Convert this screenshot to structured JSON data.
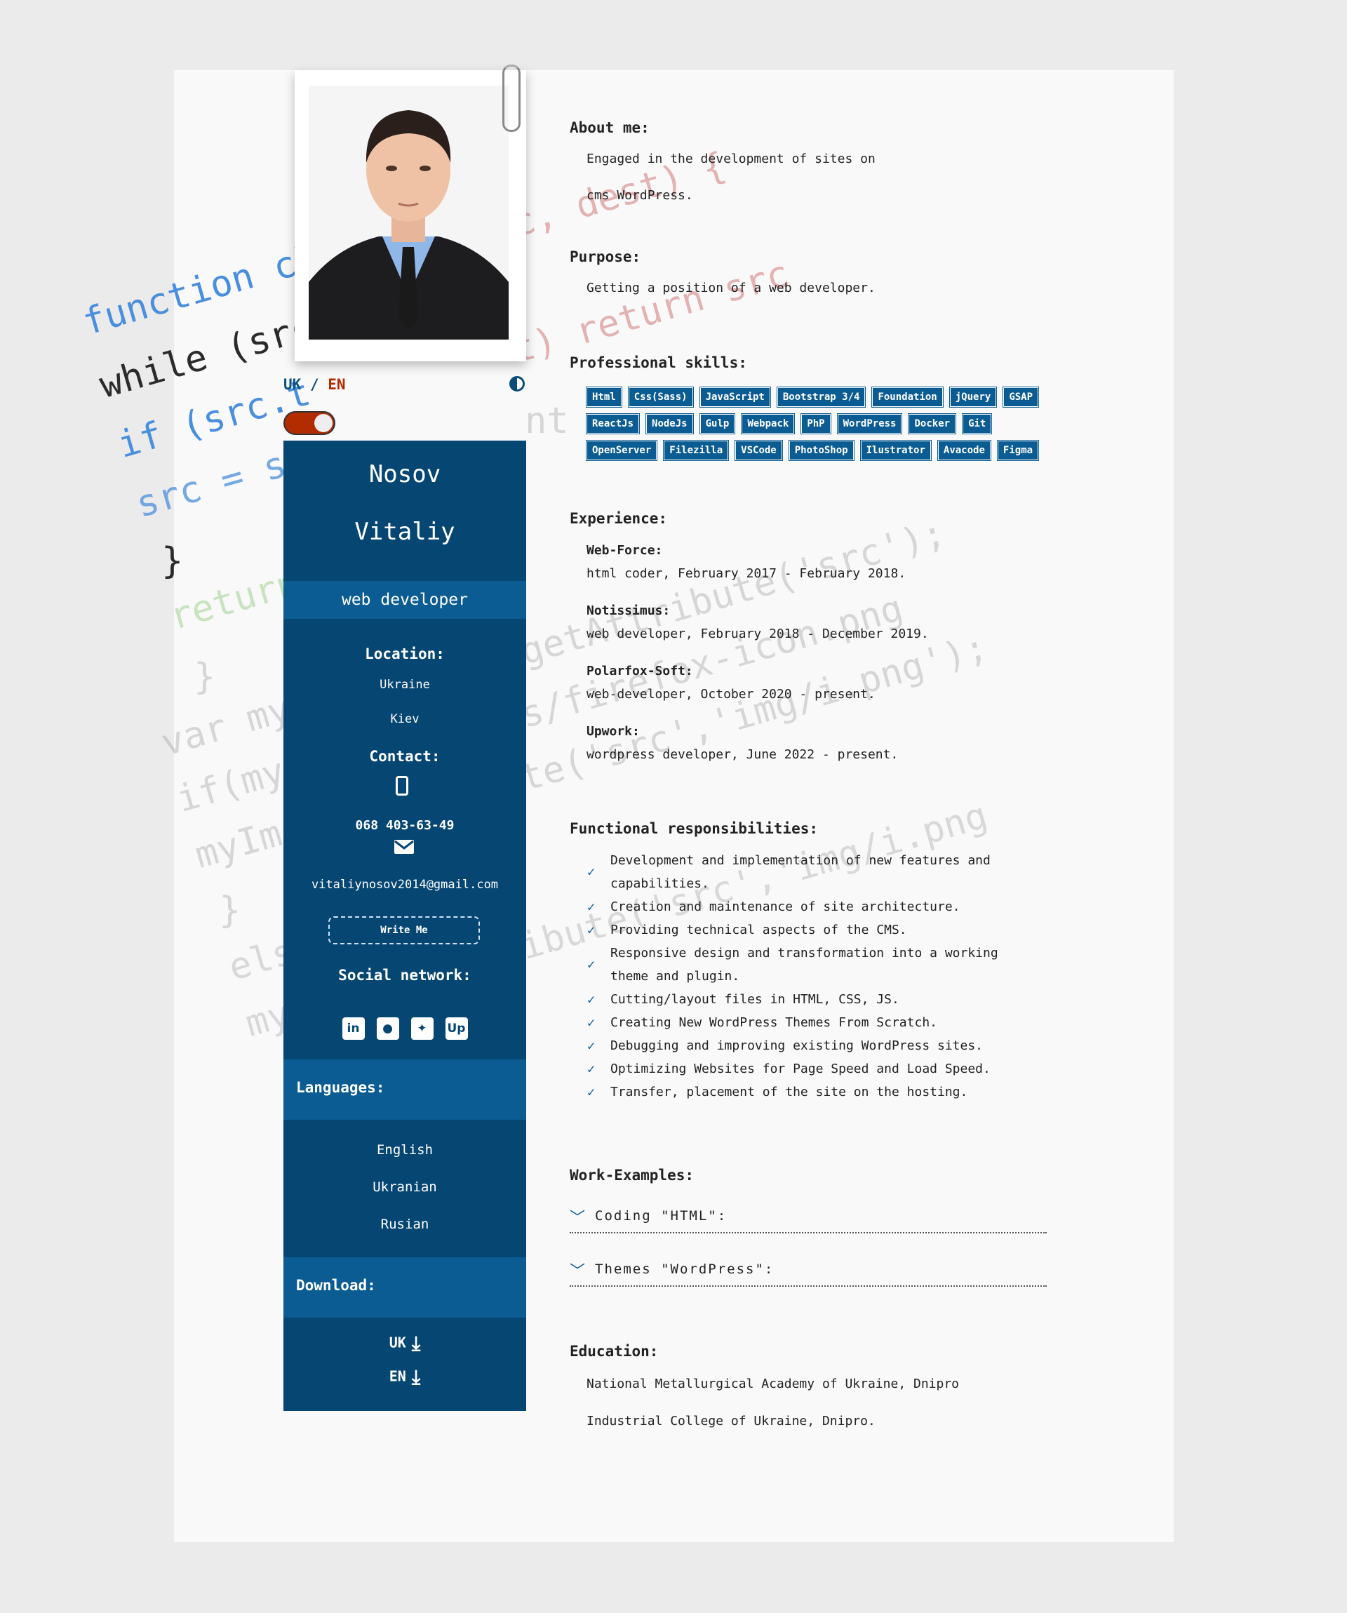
{
  "bg_code": {
    "l1": "function ch",
    "l2": "while (src",
    "l3": "if (src.t",
    "l4": "src = sr",
    "l5": "}",
    "l6": "return",
    "l7": "}",
    "l8": "var my",
    "l9": "if(my",
    "l10": "myIm",
    "l11": "}",
    "l12": "els",
    "l13": "my",
    "r1": "c, dest) {",
    "r2": "t) return src",
    "r3": "nt",
    "r4": "getAttribute('src');",
    "r5": "s/firefox-icon.png",
    "r6": "te('src','img/i.png');",
    "r7": "ibute('src','img/i.png"
  },
  "lang_switch": {
    "uk": "UK",
    "sep": "/",
    "en": "EN"
  },
  "sidebar": {
    "first_name": "Nosov",
    "last_name": "Vitaliy",
    "role": "web developer",
    "location_title": "Location:",
    "country": "Ukraine",
    "city": "Kiev",
    "contact_title": "Contact:",
    "phone": "068 403-63-49",
    "email": "vitaliynosov2014@gmail.com",
    "write_me": "Write Me",
    "social_title": "Social network:",
    "social_icons": [
      "linkedin-icon",
      "github-icon",
      "twitter-icon",
      "upwork-icon"
    ],
    "languages_title": "Languages:",
    "languages": [
      "English",
      "Ukranian",
      "Rusian"
    ],
    "download_title": "Download:",
    "download_uk": "UK",
    "download_en": "EN"
  },
  "about": {
    "title": "About me:",
    "line1": "Engaged in the development of sites on",
    "line2": "cms WordPress."
  },
  "purpose": {
    "title": "Purpose:",
    "text": "Getting a position of a web developer."
  },
  "skills": {
    "title": "Professional skills:",
    "items": [
      "Html",
      "Css(Sass)",
      "JavaScript",
      "Bootstrap 3/4",
      "Foundation",
      "jQuery",
      "GSAP",
      "ReactJs",
      "NodeJs",
      "Gulp",
      "Webpack",
      "PhP",
      "WordPress",
      "Docker",
      "Git",
      "OpenServer",
      "Filezilla",
      "VSCode",
      "PhotoShop",
      "Ilustrator",
      "Avacode",
      "Figma"
    ]
  },
  "experience": {
    "title": "Experience:",
    "jobs": [
      {
        "company": "Web-Force:",
        "detail": "html coder, February 2017 - February 2018."
      },
      {
        "company": "Notissimus:",
        "detail": "web developer, February 2018 - December 2019."
      },
      {
        "company": "Polarfox-Soft:",
        "detail": "web-developer, October 2020 - present."
      },
      {
        "company": "Upwork:",
        "detail": "wordpress developer, June 2022 - present."
      }
    ]
  },
  "responsibilities": {
    "title": "Functional responsibilities:",
    "items": [
      [
        "Development and implementation of new features and",
        "capabilities."
      ],
      [
        "Creation and maintenance of site architecture."
      ],
      [
        "Providing technical aspects of the CMS."
      ],
      [
        "Responsive design and transformation into a working",
        "theme and plugin."
      ],
      [
        "Cutting/layout files in HTML, CSS, JS."
      ],
      [
        "Creating New WordPress Themes From Scratch."
      ],
      [
        "Debugging and improving existing WordPress sites."
      ],
      [
        "Optimizing Websites for Page Speed and Load Speed."
      ],
      [
        "Transfer, placement of the site on the hosting."
      ]
    ]
  },
  "work": {
    "title": "Work-Examples:",
    "acc1": "Coding \"HTML\":",
    "acc2": "Themes \"WordPress\":"
  },
  "education": {
    "title": "Education:",
    "line1": "National Metallurgical Academy of Ukraine, Dnipro",
    "line2": "Industrial College of Ukraine, Dnipro."
  },
  "colors": {
    "sidebar": "#064672",
    "band": "#0b5c92",
    "accent_red": "#b32c00"
  }
}
